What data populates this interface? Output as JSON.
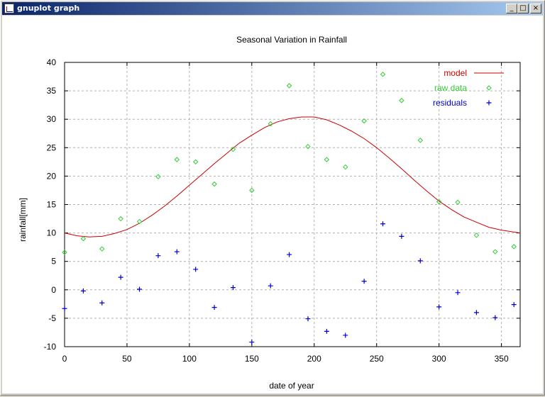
{
  "window": {
    "title": "gnuplot graph",
    "min_glyph": "_",
    "max_glyph": "□",
    "close_glyph": "×"
  },
  "chart_data": {
    "type": "scatter",
    "title": "Seasonal Variation in Rainfall",
    "xlabel": "date of year",
    "ylabel": "rainfall[mm]",
    "xlim": [
      0,
      365
    ],
    "ylim": [
      -10,
      40
    ],
    "x_ticks": [
      0,
      50,
      100,
      150,
      200,
      250,
      300,
      350
    ],
    "y_ticks": [
      -10,
      -5,
      0,
      5,
      10,
      15,
      20,
      25,
      30,
      35,
      40
    ],
    "grid": true,
    "legend_position": "top-right",
    "series": [
      {
        "name": "model",
        "kind": "line",
        "color": "#cc0000",
        "x": [
          0,
          10,
          20,
          30,
          40,
          50,
          60,
          70,
          80,
          90,
          100,
          110,
          120,
          130,
          140,
          150,
          160,
          170,
          180,
          190,
          200,
          210,
          220,
          230,
          240,
          250,
          260,
          270,
          280,
          290,
          300,
          310,
          320,
          330,
          340,
          350,
          365
        ],
        "y": [
          10.0,
          9.5,
          9.3,
          9.4,
          9.9,
          10.6,
          11.7,
          13.1,
          14.7,
          16.5,
          18.4,
          20.3,
          22.2,
          24.0,
          25.8,
          27.2,
          28.5,
          29.5,
          30.1,
          30.4,
          30.4,
          29.9,
          29.0,
          27.9,
          26.6,
          25.0,
          23.2,
          21.3,
          19.3,
          17.4,
          15.6,
          14.1,
          12.8,
          11.9,
          11.0,
          10.5,
          10.0
        ]
      },
      {
        "name": "raw data",
        "kind": "diamond",
        "color": "#33cc33",
        "x": [
          0,
          15,
          30,
          45,
          60,
          75,
          90,
          105,
          120,
          135,
          150,
          165,
          180,
          195,
          210,
          225,
          240,
          255,
          270,
          285,
          300,
          315,
          330,
          345,
          360
        ],
        "y": [
          6.6,
          9.0,
          7.2,
          12.5,
          12.0,
          19.9,
          22.9,
          22.5,
          18.6,
          24.7,
          17.5,
          29.2,
          35.9,
          25.2,
          22.9,
          21.6,
          29.7,
          37.9,
          33.3,
          26.3,
          15.5,
          15.4,
          9.6,
          6.7,
          7.6
        ]
      },
      {
        "name": "residuals",
        "kind": "plus",
        "color": "#0000cc",
        "x": [
          0,
          15,
          30,
          45,
          60,
          75,
          90,
          105,
          120,
          135,
          150,
          165,
          180,
          195,
          210,
          225,
          240,
          255,
          270,
          285,
          300,
          315,
          330,
          345,
          360
        ],
        "y": [
          -3.3,
          -0.2,
          -2.3,
          2.2,
          0.1,
          6.0,
          6.7,
          3.6,
          -3.1,
          0.4,
          -9.2,
          0.7,
          6.2,
          -5.1,
          -7.3,
          -8.0,
          1.5,
          11.6,
          9.4,
          5.1,
          -3.0,
          -0.5,
          -4.0,
          -4.9,
          -2.6
        ]
      }
    ]
  }
}
